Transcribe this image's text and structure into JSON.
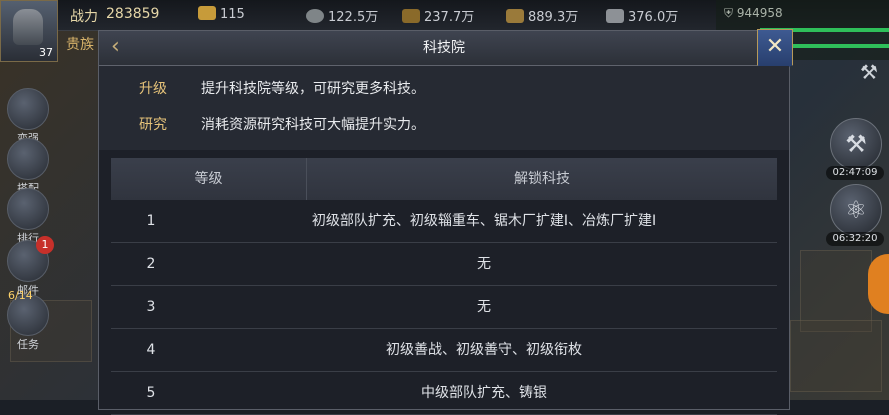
{
  "hud": {
    "player_level": "37",
    "power_label": "战力",
    "power_value": "283859",
    "gold_value": "115",
    "title_tag": "贵族",
    "resources": [
      {
        "icon": "coin-icon",
        "value": "122.5万"
      },
      {
        "icon": "food-icon",
        "value": "237.7万"
      },
      {
        "icon": "wood-icon",
        "value": "889.3万"
      },
      {
        "icon": "iron-icon",
        "value": "376.0万"
      }
    ],
    "right_value": "944958",
    "side_menu": [
      {
        "label": "变强",
        "icon": "fist-icon"
      },
      {
        "label": "搭配",
        "icon": "emblem-icon"
      },
      {
        "label": "排行",
        "icon": "ranking-icon"
      },
      {
        "label": "邮件",
        "icon": "mail-icon",
        "badge": "1"
      },
      {
        "label": "任务",
        "icon": "task-icon"
      }
    ],
    "task_count": "6/14",
    "timers": [
      "02:47:09",
      "06:32:20"
    ],
    "right_buttons": [
      {
        "icon": "hammer-icon"
      },
      {
        "icon": "atom-icon"
      }
    ]
  },
  "dialog": {
    "title": "科技院",
    "back_icon": "back-arrow-icon",
    "close_icon": "close-icon",
    "info": [
      {
        "key": "升级",
        "value": "提升科技院等级，可研究更多科技。"
      },
      {
        "key": "研究",
        "value": "消耗资源研究科技可大幅提升实力。"
      }
    ],
    "table": {
      "headers": [
        "等级",
        "解锁科技"
      ],
      "rows": [
        {
          "level": "1",
          "unlock": "初级部队扩充、初级辎重车、锯木厂扩建Ⅰ、冶炼厂扩建Ⅰ"
        },
        {
          "level": "2",
          "unlock": "无"
        },
        {
          "level": "3",
          "unlock": "无"
        },
        {
          "level": "4",
          "unlock": "初级善战、初级善守、初级衔枚"
        },
        {
          "level": "5",
          "unlock": "中级部队扩充、铸银"
        }
      ]
    }
  },
  "colors": {
    "gold_text": "#e6c37a",
    "accent_blue": "#3e5a92",
    "badge_red": "#c7302a"
  }
}
